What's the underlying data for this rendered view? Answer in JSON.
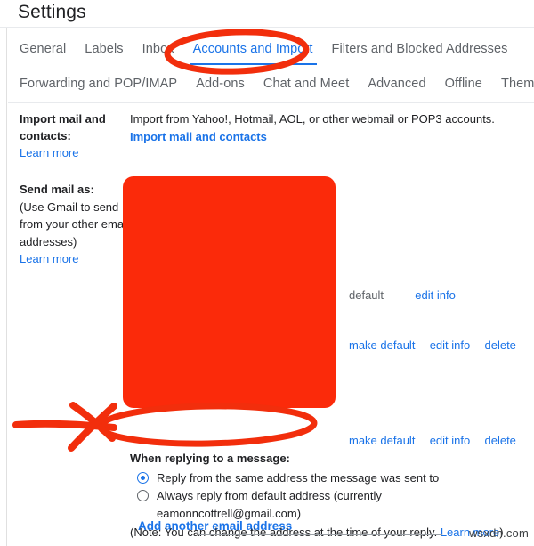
{
  "header": {
    "title": "Settings"
  },
  "tabs": {
    "row1": [
      {
        "label": "General",
        "active": false
      },
      {
        "label": "Labels",
        "active": false
      },
      {
        "label": "Inbox",
        "active": false
      },
      {
        "label": "Accounts and Import",
        "active": true
      },
      {
        "label": "Filters and Blocked Addresses",
        "active": false
      }
    ],
    "row2": [
      {
        "label": "Forwarding and POP/IMAP",
        "active": false
      },
      {
        "label": "Add-ons",
        "active": false
      },
      {
        "label": "Chat and Meet",
        "active": false
      },
      {
        "label": "Advanced",
        "active": false
      },
      {
        "label": "Offline",
        "active": false
      },
      {
        "label": "Themes",
        "active": false
      }
    ]
  },
  "import_section": {
    "label_line1": "Import mail and",
    "label_line2": "contacts:",
    "learn_more": "Learn more",
    "description": "Import from Yahoo!, Hotmail, AOL, or other webmail or POP3 accounts.",
    "action_link": "Import mail and contacts"
  },
  "send_mail_as": {
    "title": "Send mail as:",
    "note_line1": "(Use Gmail to send",
    "note_line2": "from your other email",
    "note_line3": "addresses)",
    "learn_more": "Learn more",
    "rows": [
      {
        "address": "",
        "status": "default",
        "actions": [
          "edit info"
        ]
      },
      {
        "address": "",
        "status": "",
        "actions": [
          "make default",
          "edit info",
          "delete"
        ]
      },
      {
        "address": "",
        "status": "",
        "actions": [
          "make default",
          "edit info",
          "delete"
        ]
      }
    ],
    "add_another": "Add another email address"
  },
  "reply_settings": {
    "heading": "When replying to a message:",
    "options": [
      {
        "label": "Reply from the same address the message was sent to",
        "selected": true
      },
      {
        "label": "Always reply from default address (currently",
        "label_line2": "eamonncottrell@gmail.com)",
        "selected": false
      }
    ],
    "note_prefix": "(Note: You can change the address at the time of your reply. ",
    "note_link": "Learn more",
    "note_suffix": ")"
  },
  "watermark": {
    "text": "wsxdn.com"
  },
  "annotations": {
    "redaction_color": "#fb2a0a",
    "ink_color": "#f22e0c",
    "marks": [
      {
        "name": "ellipse-around-accounts-and-import-tab"
      },
      {
        "name": "red-redaction-block-over-email-addresses"
      },
      {
        "name": "ellipse-around-add-another-email-address"
      },
      {
        "name": "arrow-pointing-to-add-another-email-address"
      }
    ]
  },
  "colors": {
    "link_blue": "#1a73e8",
    "text_primary": "#202124",
    "text_secondary": "#5f6368",
    "divider": "#e0e0e0"
  }
}
